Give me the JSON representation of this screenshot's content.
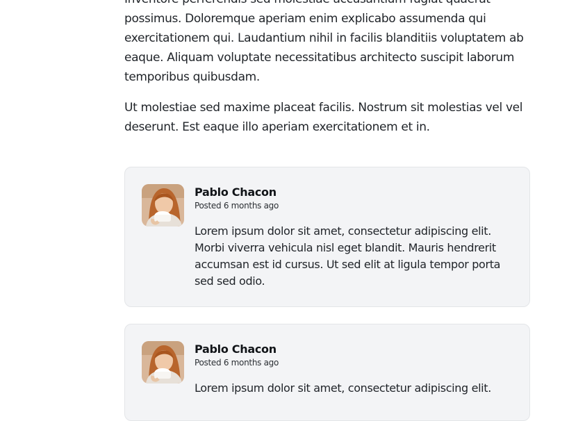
{
  "article": {
    "paragraphs": [
      "Inventore perferendis sed molestiae accusantium fugiat quaerat possimus. Doloremque aperiam enim explicabo assumenda qui exercitationem qui. Laudantium nihil in facilis blanditiis voluptatem ab eaque. Aliquam voluptate necessitatibus architecto suscipit laborum temporibus quibusdam.",
      "Ut molestiae sed maxime placeat facilis. Nostrum sit molestias vel vel deserunt. Est eaque illo aperiam exercitationem et in."
    ]
  },
  "comments": [
    {
      "author": "Pablo Chacon",
      "posted": "Posted 6 months ago",
      "body": "Lorem ipsum dolor sit amet, consectetur adipiscing elit. Morbi viverra vehicula nisl eget blandit. Mauris hendrerit accumsan est id cursus. Ut sed elit at ligula tempor porta sed sed odio."
    },
    {
      "author": "Pablo Chacon",
      "posted": "Posted 6 months ago",
      "body": "Lorem ipsum dolor sit amet, consectetur adipiscing elit."
    }
  ]
}
